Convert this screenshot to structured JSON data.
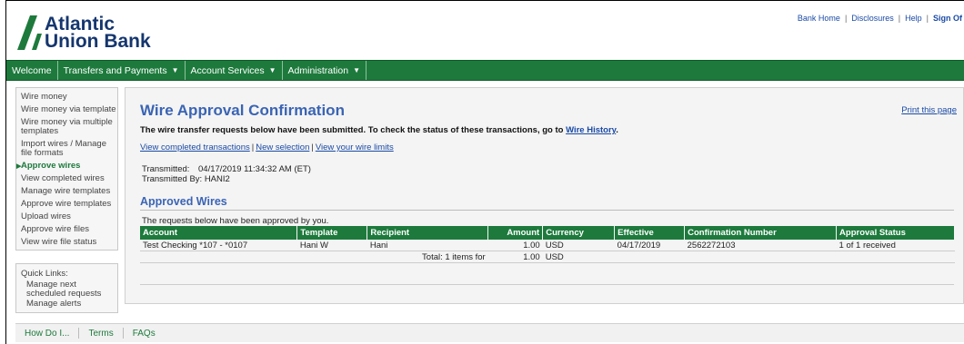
{
  "brand": {
    "line1": "Atlantic",
    "line2": "Union Bank",
    "color": "#15366e",
    "accent": "#1d7a3c"
  },
  "utility": {
    "bank_home": "Bank Home",
    "disclosures": "Disclosures",
    "help": "Help",
    "sign_off": "Sign Of"
  },
  "nav": {
    "welcome": "Welcome",
    "transfers": "Transfers and Payments",
    "account_services": "Account Services",
    "administration": "Administration"
  },
  "sidebar": {
    "items": [
      "Wire money",
      "Wire money via template",
      "Wire money via multiple templates",
      "Import wires / Manage file formats",
      "Approve wires",
      "View completed wires",
      "Manage wire templates",
      "Approve wire templates",
      "Upload wires",
      "Approve wire files",
      "View wire file status"
    ]
  },
  "quick_links": {
    "title": "Quick Links:",
    "items": [
      "Manage next scheduled requests",
      "Manage alerts"
    ]
  },
  "main": {
    "title": "Wire Approval Confirmation",
    "print": "Print this page",
    "info_text": "The wire transfer requests below have been submitted. To check the status of these transactions, go to ",
    "info_link": "Wire History",
    "info_end": ".",
    "link_completed": "View completed transactions",
    "link_new": "New selection",
    "link_limits": "View your wire limits",
    "transmitted_label": "Transmitted:",
    "transmitted_value": "04/17/2019 11:34:32 AM (ET)",
    "transmitted_by_label": "Transmitted By:",
    "transmitted_by_value": "HANI2",
    "section_title": "Approved Wires",
    "approved_note": "The requests below have been approved by you."
  },
  "table": {
    "headers": {
      "account": "Account",
      "template": "Template",
      "recipient": "Recipient",
      "amount": "Amount",
      "currency": "Currency",
      "effective": "Effective",
      "confirmation": "Confirmation Number",
      "status": "Approval Status"
    },
    "row": {
      "account": "Test Checking *107 - *0107",
      "template": "Hani W",
      "recipient": "Hani",
      "amount": "1.00",
      "currency": "USD",
      "effective": "04/17/2019",
      "confirmation": "2562272103",
      "status": "1 of 1 received"
    },
    "total": {
      "label": "Total: 1 items for",
      "amount": "1.00",
      "currency": "USD"
    }
  },
  "footer": {
    "how": "How Do I...",
    "terms": "Terms",
    "faqs": "FAQs"
  }
}
